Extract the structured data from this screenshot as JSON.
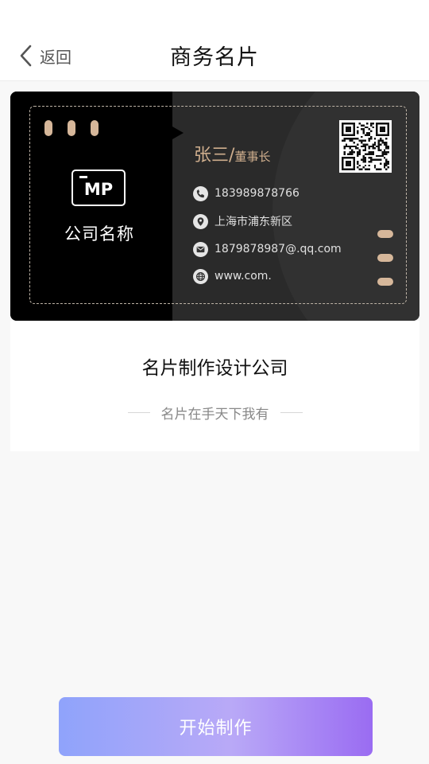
{
  "header": {
    "back_label": "返回",
    "title": "商务名片"
  },
  "card": {
    "logo_text": "MP",
    "company_name": "公司名称",
    "person_name": "张三",
    "person_separator": "/",
    "person_title": "董事长",
    "phone": "183989878766",
    "address": "上海市浦东新区",
    "email": "1879878987@.qq.com",
    "website": "www.com.",
    "icons": [
      "phone-icon",
      "location-icon",
      "mail-icon",
      "globe-icon",
      "qr-code-icon"
    ],
    "colors": {
      "accent": "#cfae8d",
      "pill": "#d6b79a",
      "left_panel": "#000000",
      "body": "#2a2a2a"
    }
  },
  "panel": {
    "title": "名片制作设计公司",
    "tagline": "名片在手天下我有"
  },
  "actions": {
    "start_label": "开始制作",
    "gradient": [
      "#8fa3fb",
      "#b9a9f7",
      "#9a6cf2"
    ]
  }
}
